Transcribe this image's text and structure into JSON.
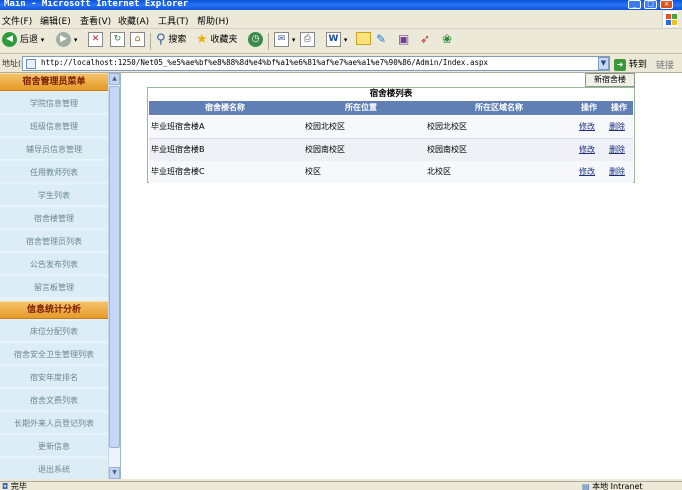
{
  "window": {
    "title": "Main - Microsoft Internet Explorer",
    "min_label": "_",
    "max_label": "□",
    "close_label": "×"
  },
  "menu": {
    "items": [
      "文件(F)",
      "编辑(E)",
      "查看(V)",
      "收藏(A)",
      "工具(T)",
      "帮助(H)"
    ]
  },
  "toolbar": {
    "back_label": "后退",
    "search_label": "搜索",
    "favorites_label": "收藏夹"
  },
  "address": {
    "label": "地址(D)",
    "url": "http://localhost:1250/Net05_%e5%ae%bf%e8%88%8d%e4%bf%a1%e6%81%af%e7%ae%a1%e7%90%86/Admin/Index.aspx",
    "go_label": "转到",
    "links_label": "链接"
  },
  "sidebar": {
    "section1_title": "宿舍管理员菜单",
    "section1_items": [
      "学院信息管理",
      "班级信息管理",
      "辅导员信息管理",
      "任用教师列表",
      "学生列表",
      "宿舍楼管理",
      "宿舍管理员列表",
      "公告发布列表",
      "留言板管理"
    ],
    "section2_title": "信息统计分析",
    "section2_items": [
      "床位分配列表",
      "宿舍安全卫生管理列表",
      "宿安年度排名",
      "宿舍文费列表",
      "长期外来人员登记列表",
      "更新信息",
      "退出系统"
    ]
  },
  "main": {
    "new_button_label": "新宿舍楼",
    "table_title": "宿舍楼列表",
    "columns": [
      "宿舍楼名称",
      "所在位置",
      "所在区域名称",
      "操作",
      "操作"
    ],
    "rows": [
      {
        "name": "毕业班宿舍楼A",
        "location": "校园北校区",
        "region": "校园北校区",
        "edit": "修改",
        "delete": "删除"
      },
      {
        "name": "毕业班宿舍楼B",
        "location": "校园南校区",
        "region": "校园南校区",
        "edit": "修改",
        "delete": "删除"
      },
      {
        "name": "毕业班宿舍楼C",
        "location": "校区",
        "region": "北校区",
        "edit": "修改",
        "delete": "删除"
      }
    ]
  },
  "status": {
    "left": "完毕",
    "zone": "本地 Intranet"
  },
  "colors": {
    "titlebar": "#0a52d8",
    "section_header": "#e59a28",
    "table_header": "#5f7fb5",
    "sidebar_bg": "#e2f1f9"
  }
}
